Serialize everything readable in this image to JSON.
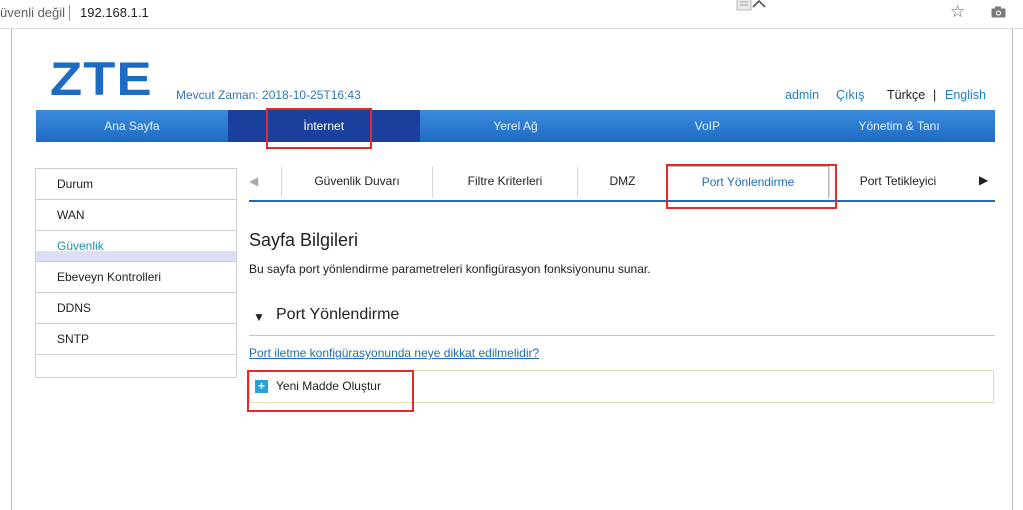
{
  "browser": {
    "security_text": "üvenli değil",
    "url": "192.168.1.1",
    "star_icon": "star-icon",
    "camera_icon": "camera-icon"
  },
  "header": {
    "logo": "ZTE",
    "current_time": "Mevcut Zaman: 2018-10-25T16:43",
    "user": "admin",
    "logout": "Çıkış",
    "lang_tr": "Türkçe",
    "lang_sep": "|",
    "lang_en": "English"
  },
  "mainnav": {
    "items": [
      "Ana Sayfa",
      "İnternet",
      "Yerel Ağ",
      "VoIP",
      "Yönetim & Tanı"
    ],
    "active_index": 1
  },
  "sidebar": {
    "items": [
      "Durum",
      "WAN",
      "Güvenlik",
      "Ebeveyn Kontrolleri",
      "DDNS",
      "SNTP"
    ],
    "active_index": 2
  },
  "tabs": {
    "items": [
      "Güvenlik Duvarı",
      "Filtre Kriterleri",
      "DMZ",
      "Port Yönlendirme",
      "Port Tetikleyici"
    ],
    "active_index": 3,
    "left_arrow": "◀",
    "right_arrow": "▶"
  },
  "content": {
    "title": "Sayfa Bilgileri",
    "description": "Bu sayfa port yönlendirme parametreleri konfigürasyon fonksiyonunu sunar.",
    "section_title": "Port Yönlendirme",
    "section_toggle": "▼",
    "help_link": "Port iletme konfigürasyonunda neye dikkat edilmelidir?",
    "new_item_label": "Yeni Madde Oluştur",
    "new_item_icon": "+"
  },
  "colors": {
    "brand": "#1e6bc4",
    "nav_active": "#1a3f9c",
    "highlight": "#e52a2a"
  }
}
